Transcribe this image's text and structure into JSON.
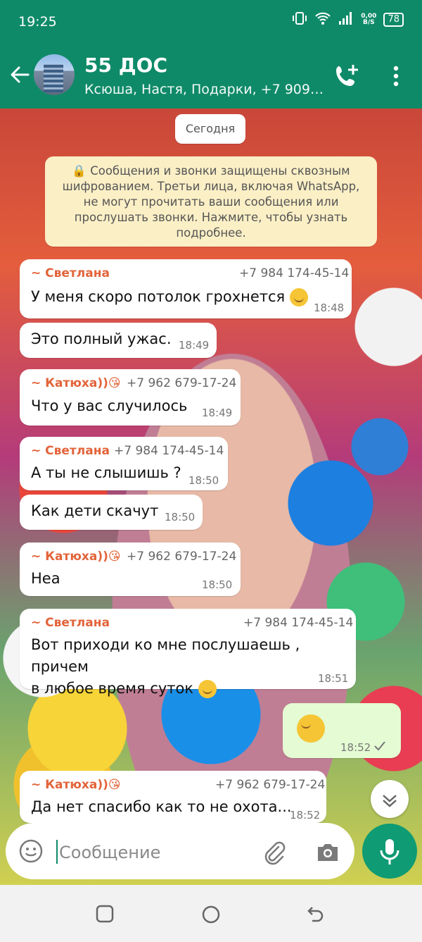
{
  "status_bar": {
    "time": "19:25",
    "net_rate_value": "0,00",
    "net_rate_unit": "B/S",
    "battery": "78"
  },
  "header": {
    "title": "55 ДОС",
    "subtitle": "Ксюша, Настя, Подарки, +7 909…"
  },
  "chat": {
    "date_chip": "Сегодня",
    "encryption_notice": "Сообщения и звонки защищены сквозным шифрованием. Третьи лица, включая WhatsApp, не могут прочитать ваши сообщения или прослушать звонки. Нажмите, чтобы узнать подробнее.",
    "messages": [
      {
        "sender": "~ Светлана",
        "phone": "+7 984 174-45-14",
        "text": "У меня скоро потолок грохнется",
        "time": "18:48"
      },
      {
        "text": "Это полный ужас.",
        "time": "18:49"
      },
      {
        "sender": "~ Катюха))😘",
        "phone": "+7 962 679-17-24",
        "text": "Что у вас случилось",
        "time": "18:49"
      },
      {
        "sender": "~ Светлана",
        "phone": "+7 984 174-45-14",
        "text": "А ты не слышишь ?",
        "time": "18:50"
      },
      {
        "text": "Как дети скачут",
        "time": "18:50"
      },
      {
        "sender": "~ Катюха))😘",
        "phone": "+7 962 679-17-24",
        "text": "Неа",
        "time": "18:50"
      },
      {
        "sender": "~ Светлана",
        "phone": "+7 984 174-45-14",
        "text_line1": "Вот приходи ко мне послушаешь , причем",
        "text_line2": "в любое время суток",
        "time": "18:51"
      },
      {
        "outgoing": true,
        "time": "18:52"
      },
      {
        "sender": "~ Катюха))😘",
        "phone": "+7 962 679-17-24",
        "text": "Да нет спасибо как то не охота...",
        "time": "18:52"
      }
    ]
  },
  "composer": {
    "placeholder": "Сообщение"
  },
  "colors": {
    "brand": "#0f8a68",
    "bubble_out": "#e4fbd3",
    "notice": "#fbefc6",
    "sender": "#e2643a"
  }
}
